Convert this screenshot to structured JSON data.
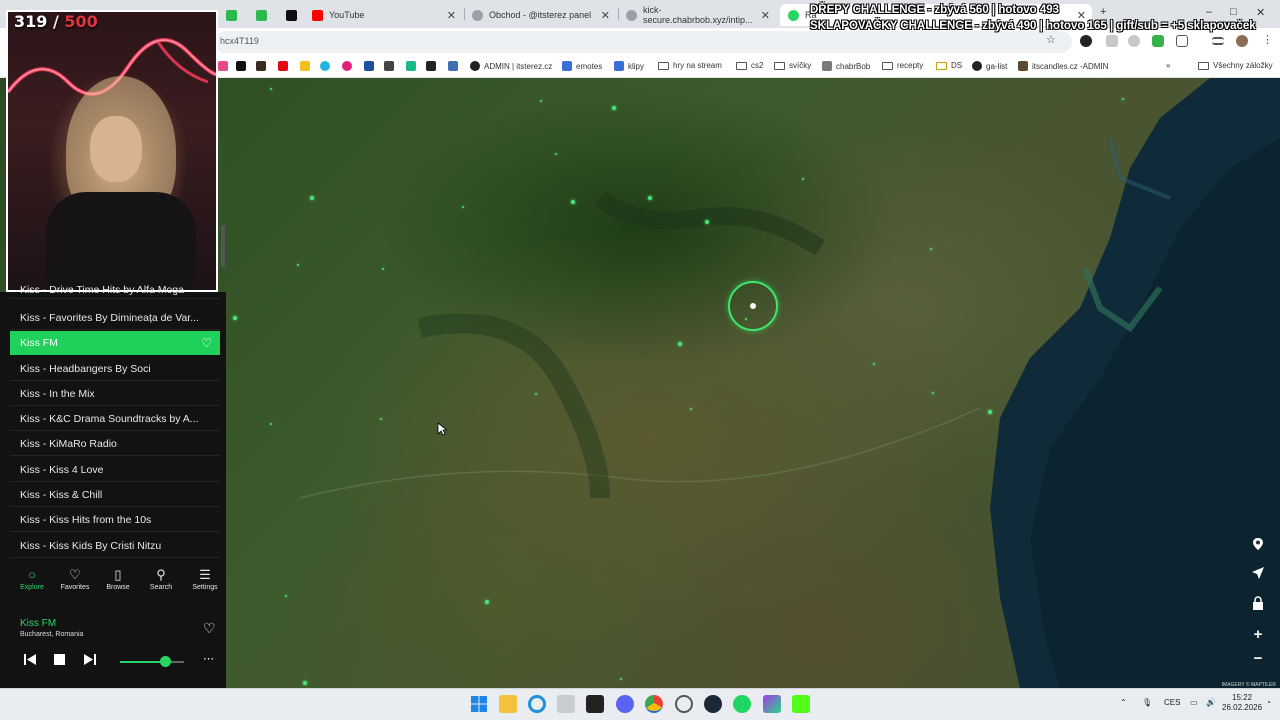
{
  "browser": {
    "tabs": [
      {
        "label": "YouTube",
        "color": "#ff0000"
      },
      {
        "label": "Obchod - @itsterez panel",
        "color": "#9aa0a6"
      },
      {
        "label": "kick-secure.chabrbob.xyz/intip...",
        "color": "#9aa0a6"
      },
      {
        "label": "Ra",
        "color": "#27d662"
      }
    ],
    "url": "hcx4T119",
    "window_controls": {
      "minimize": "–",
      "maximize": "□",
      "close": "✕"
    }
  },
  "bookmarks": [
    {
      "label": "ADMIN | itsterez.cz",
      "icon": "github-icon"
    },
    {
      "label": "emotes",
      "icon": "sl-icon"
    },
    {
      "label": "klipy",
      "icon": "sl-icon"
    },
    {
      "label": "hry na stream",
      "icon": "folder-icon"
    },
    {
      "label": "cs2",
      "icon": "folder-icon"
    },
    {
      "label": "svíčky",
      "icon": "folder-icon"
    },
    {
      "label": "chabrBob",
      "icon": "chabrbob-icon"
    },
    {
      "label": "recepty",
      "icon": "folder-icon"
    },
    {
      "label": "DS",
      "icon": "folder-icon"
    },
    {
      "label": "ga-list",
      "icon": "github-icon"
    },
    {
      "label": "itscandles.cz -ADMIN",
      "icon": "candle-icon"
    },
    {
      "label": "Všechny záložky",
      "icon": "folder-icon"
    }
  ],
  "overlay": {
    "counter_current": "319",
    "counter_sep": "/",
    "counter_max": "500",
    "challenge_line1": "DŘEPY CHALLENGE - zbývá 560 | hotovo 493",
    "challenge_line2": "SKLAPOVAČKY CHALLENGE - zbývá 490 | hotovo 165 | gift/sub = +5 sklapovaček"
  },
  "radio": {
    "stations": [
      {
        "label": "Kiss - Drive Time Hits by Alfa Moga",
        "active": false
      },
      {
        "label": "Kiss - Favorites By Dimineața de Var...",
        "active": false
      },
      {
        "label": "Kiss FM",
        "active": true
      },
      {
        "label": "Kiss - Headbangers By Soci",
        "active": false
      },
      {
        "label": "Kiss - In the Mix",
        "active": false
      },
      {
        "label": "Kiss - K&C Drama Soundtracks by A...",
        "active": false
      },
      {
        "label": "Kiss - KiMaRo Radio",
        "active": false
      },
      {
        "label": "Kiss - Kiss 4 Love",
        "active": false
      },
      {
        "label": "Kiss - Kiss & Chill",
        "active": false
      },
      {
        "label": "Kiss - Kiss Hits from the 10s",
        "active": false
      },
      {
        "label": "Kiss - Kiss Kids By Cristi Nitzu",
        "active": false
      }
    ],
    "nav": [
      {
        "label": "Explore",
        "icon": "explore-icon",
        "active": true
      },
      {
        "label": "Favorites",
        "icon": "heart-icon",
        "active": false
      },
      {
        "label": "Browse",
        "icon": "map-icon",
        "active": false
      },
      {
        "label": "Search",
        "icon": "search-icon",
        "active": false
      },
      {
        "label": "Settings",
        "icon": "menu-icon",
        "active": false
      }
    ],
    "now_playing": {
      "station": "Kiss FM",
      "location": "Bucharest, Romania",
      "volume": 0.7
    },
    "accent": "#27d662"
  },
  "map": {
    "attribution": "IMAGERY © MAPTILER"
  },
  "taskbar": {
    "language": "CES",
    "time": "15:22",
    "date": "26.02.2026"
  }
}
